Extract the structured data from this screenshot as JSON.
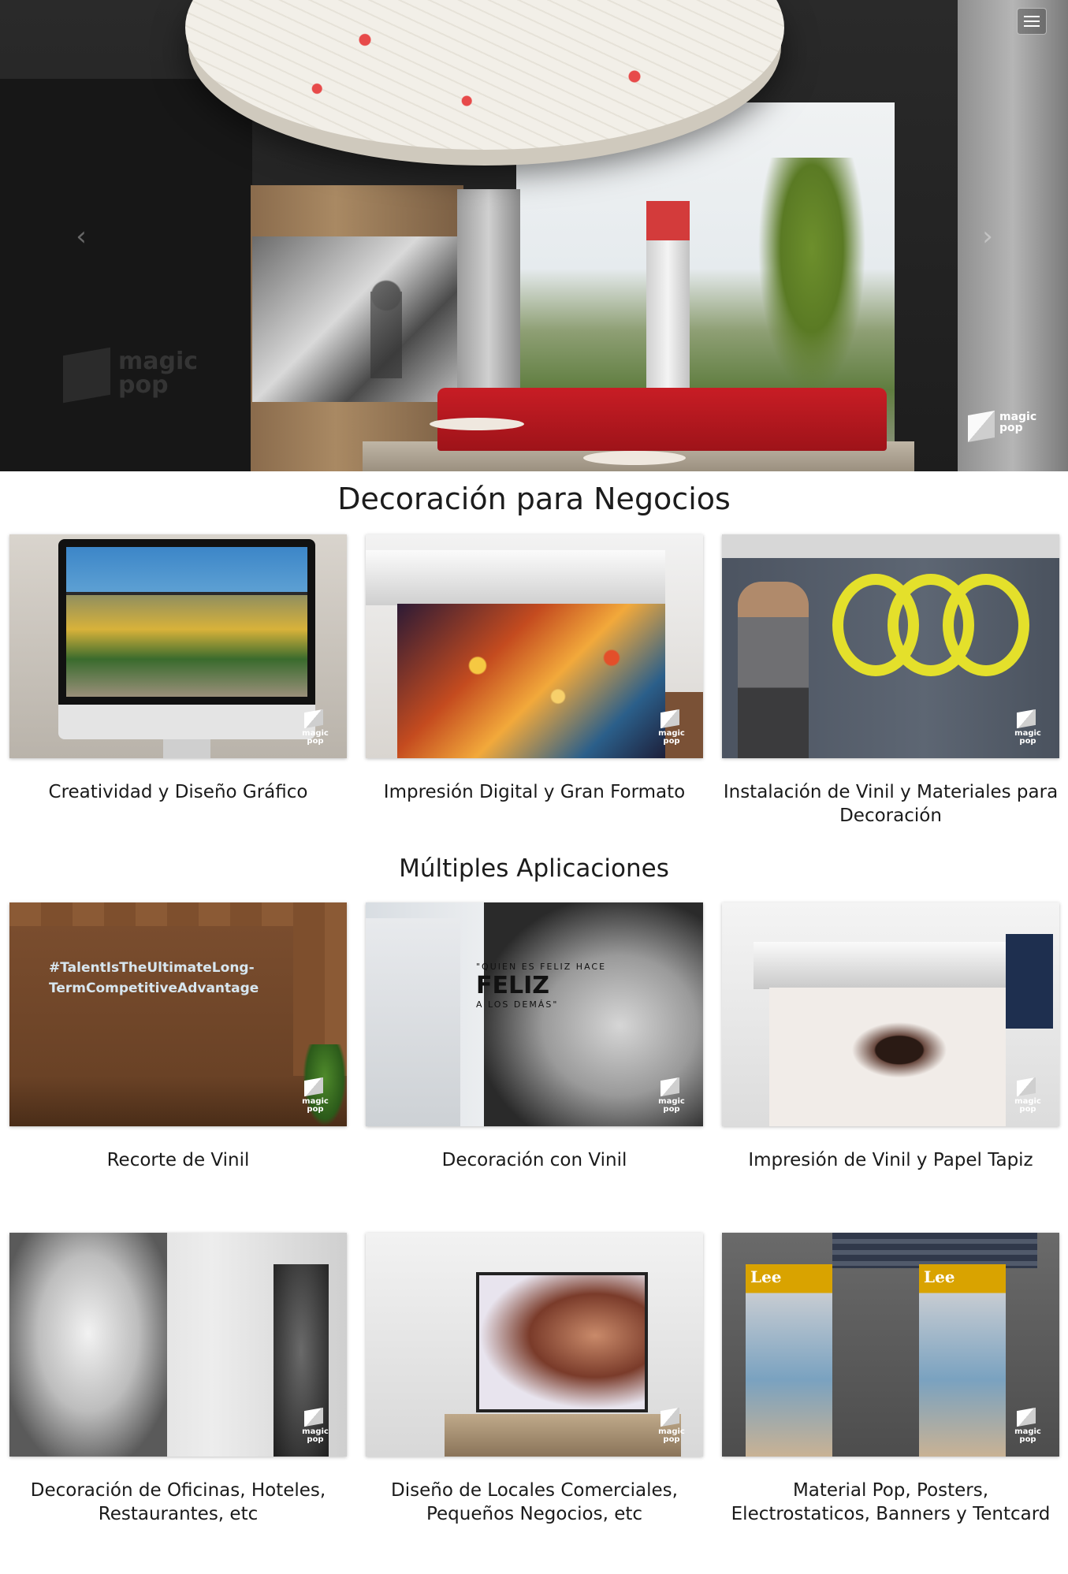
{
  "hero": {
    "prev_arrow": "‹",
    "next_arrow": "›",
    "logo_text_1": "magic",
    "logo_text_2": "pop",
    "menu_icon": "hamburger-icon"
  },
  "sections": {
    "business_title": "Decoración para Negocios",
    "applications_title": "Múltiples Aplicaciones"
  },
  "business_cards": [
    {
      "caption": "Creatividad y Diseño Gráfico"
    },
    {
      "caption": "Impresión Digital y Gran Formato"
    },
    {
      "caption": "Instalación de Vinil y Materiales para Decoración"
    }
  ],
  "application_cards": [
    {
      "caption": "Recorte de Vinil"
    },
    {
      "caption": "Decoración con Vinil"
    },
    {
      "caption": "Impresión de Vinil y Papel Tapiz"
    },
    {
      "caption": "Decoración de Oficinas, Hoteles, Restaurantes, etc"
    },
    {
      "caption": "Diseño de Locales Comerciales, Pequeños Negocios, etc"
    },
    {
      "caption": "Material Pop, Posters, Electrostaticos, Banners y Tentcard"
    }
  ],
  "image_texts": {
    "wall_line_1": "#TalentIsTheUltimateLong-",
    "wall_line_2_a": "Term",
    "wall_line_2_b": "CompetitiveAdvantage",
    "quote_small": "\"QUIEN ES FELIZ HACE",
    "quote_big": "FELIZ",
    "quote_end": "A LOS DEMÁS\"",
    "card_logo_1": "magic",
    "card_logo_2": "pop"
  },
  "colors": {
    "accent_red": "#c81d25",
    "background": "#ffffff",
    "text": "#1c1c1c"
  }
}
